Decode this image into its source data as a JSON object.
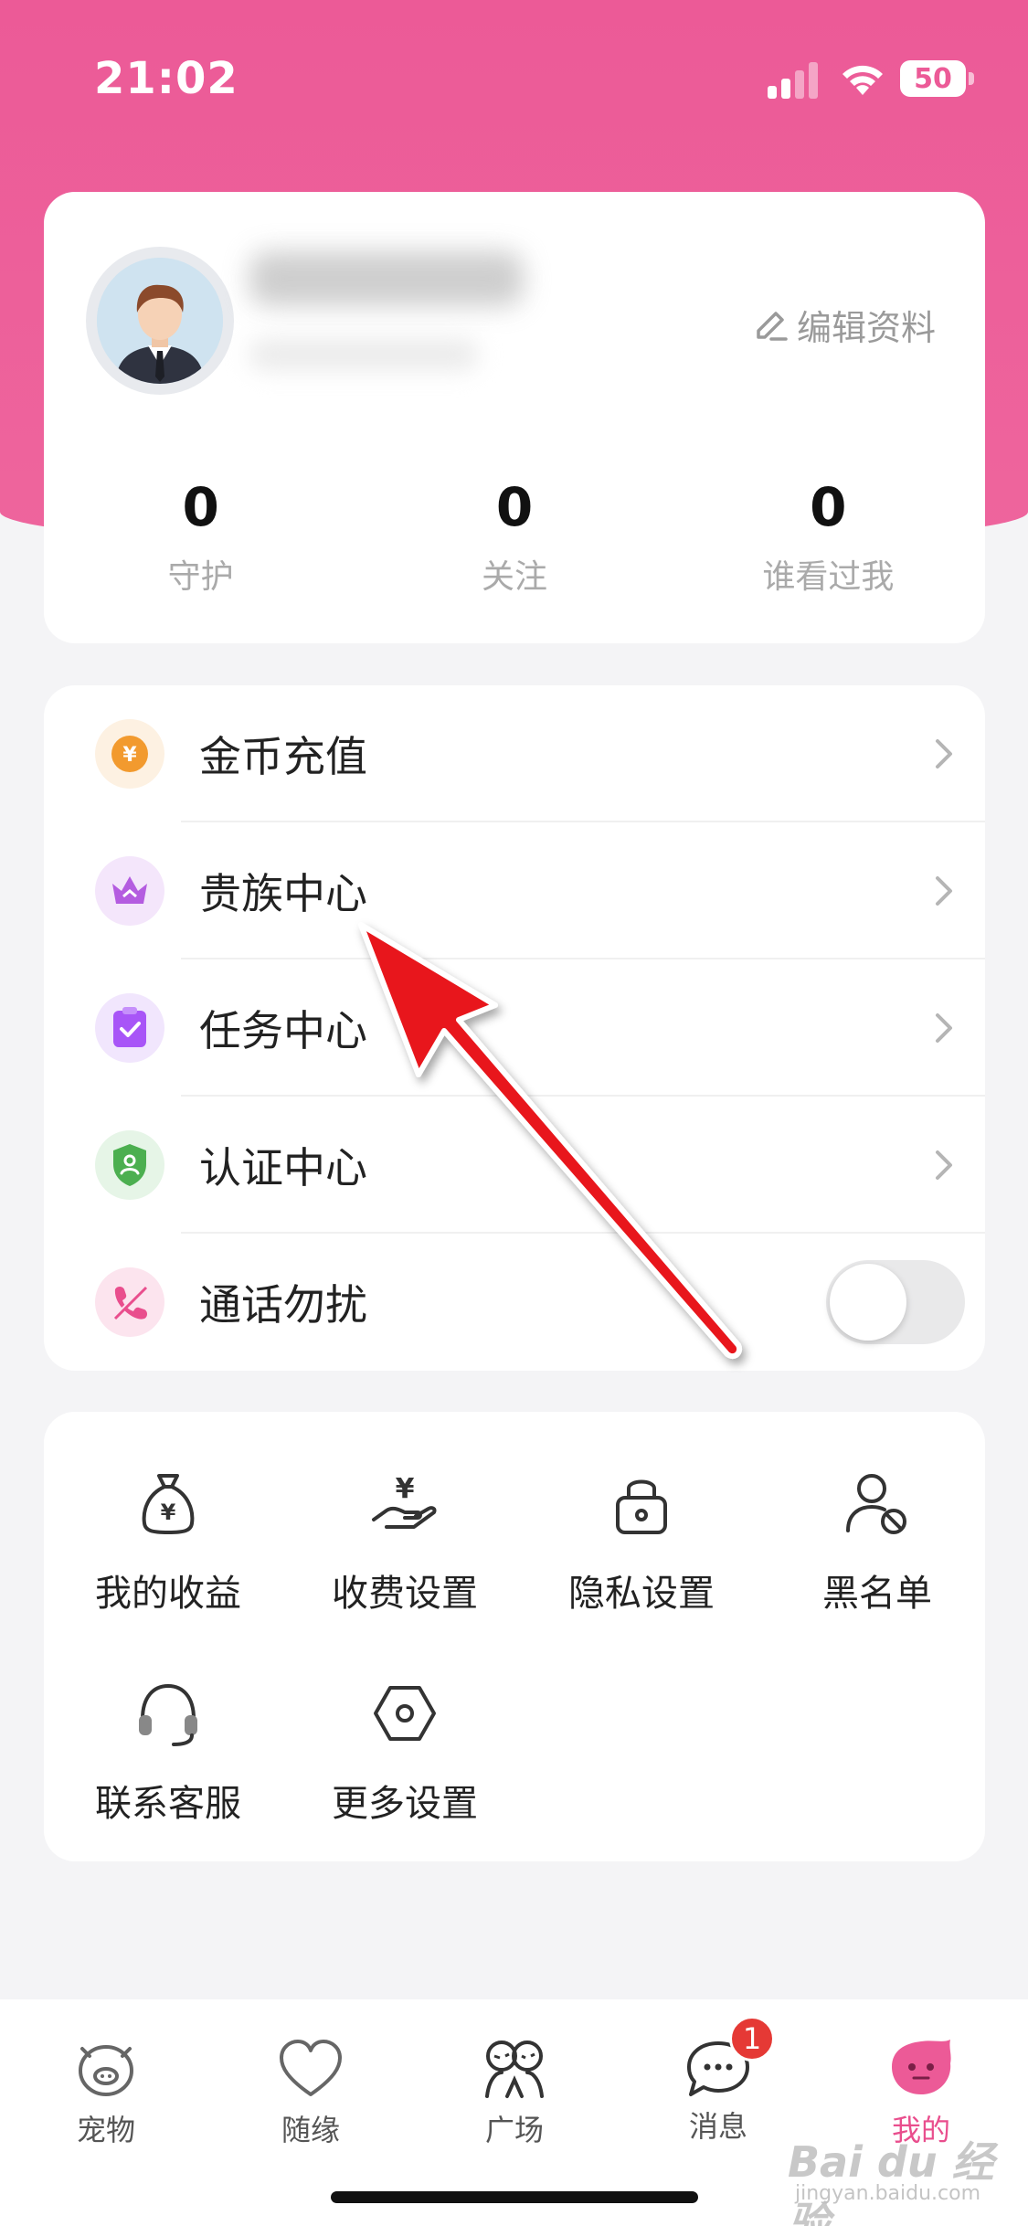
{
  "status_bar": {
    "time": "21:02",
    "battery": "50",
    "icons": [
      "signal-icon",
      "wifi-icon",
      "battery-icon"
    ]
  },
  "profile": {
    "edit_label": "编辑资料",
    "stats": [
      {
        "value": "0",
        "label": "守护"
      },
      {
        "value": "0",
        "label": "关注"
      },
      {
        "value": "0",
        "label": "谁看过我"
      }
    ]
  },
  "menu": {
    "items": [
      {
        "label": "金币充值",
        "icon": "coin-icon",
        "color": "#f29a2e"
      },
      {
        "label": "贵族中心",
        "icon": "crown-icon",
        "color": "#b45ce0"
      },
      {
        "label": "任务中心",
        "icon": "clipboard-check-icon",
        "color": "#a855f7"
      },
      {
        "label": "认证中心",
        "icon": "shield-icon",
        "color": "#4caf50"
      },
      {
        "label": "通话勿扰",
        "icon": "phone-mute-icon",
        "color": "#e94e8d",
        "toggle": false
      }
    ]
  },
  "tools": {
    "items": [
      {
        "label": "我的收益",
        "icon": "money-bag-icon"
      },
      {
        "label": "收费设置",
        "icon": "hand-coin-icon"
      },
      {
        "label": "隐私设置",
        "icon": "lock-icon"
      },
      {
        "label": "黑名单",
        "icon": "user-block-icon"
      },
      {
        "label": "联系客服",
        "icon": "headset-icon"
      },
      {
        "label": "更多设置",
        "icon": "hexagon-settings-icon"
      }
    ]
  },
  "tab_bar": {
    "tabs": [
      {
        "label": "宠物",
        "icon": "pig-icon"
      },
      {
        "label": "随缘",
        "icon": "heart-icon"
      },
      {
        "label": "广场",
        "icon": "people-icon"
      },
      {
        "label": "消息",
        "icon": "chat-icon",
        "badge": "1"
      },
      {
        "label": "我的",
        "icon": "profile-blob-icon",
        "active": true
      }
    ]
  },
  "watermark": {
    "text": "Bai du 经验",
    "sub": "jingyan.baidu.com"
  },
  "colors": {
    "brand": "#ec5a97",
    "active_tab": "#e94e8d",
    "arrow": "#e8141c"
  }
}
